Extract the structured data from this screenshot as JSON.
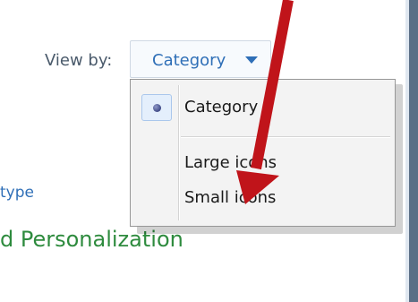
{
  "view_by": {
    "label": "View by:",
    "value": "Category"
  },
  "dropdown_menu": {
    "items": [
      {
        "label": "Category",
        "selected": true
      },
      {
        "label": "Large icons",
        "selected": false
      },
      {
        "label": "Small icons",
        "selected": false
      }
    ]
  },
  "background": {
    "type_fragment": "type",
    "personalization_fragment": "d Personalization"
  },
  "annotation": {
    "arrow_color": "#c0141a"
  },
  "colors": {
    "link_blue": "#2f6fb7",
    "category_green": "#2e8b3e",
    "menu_bg": "#f3f3f3"
  }
}
